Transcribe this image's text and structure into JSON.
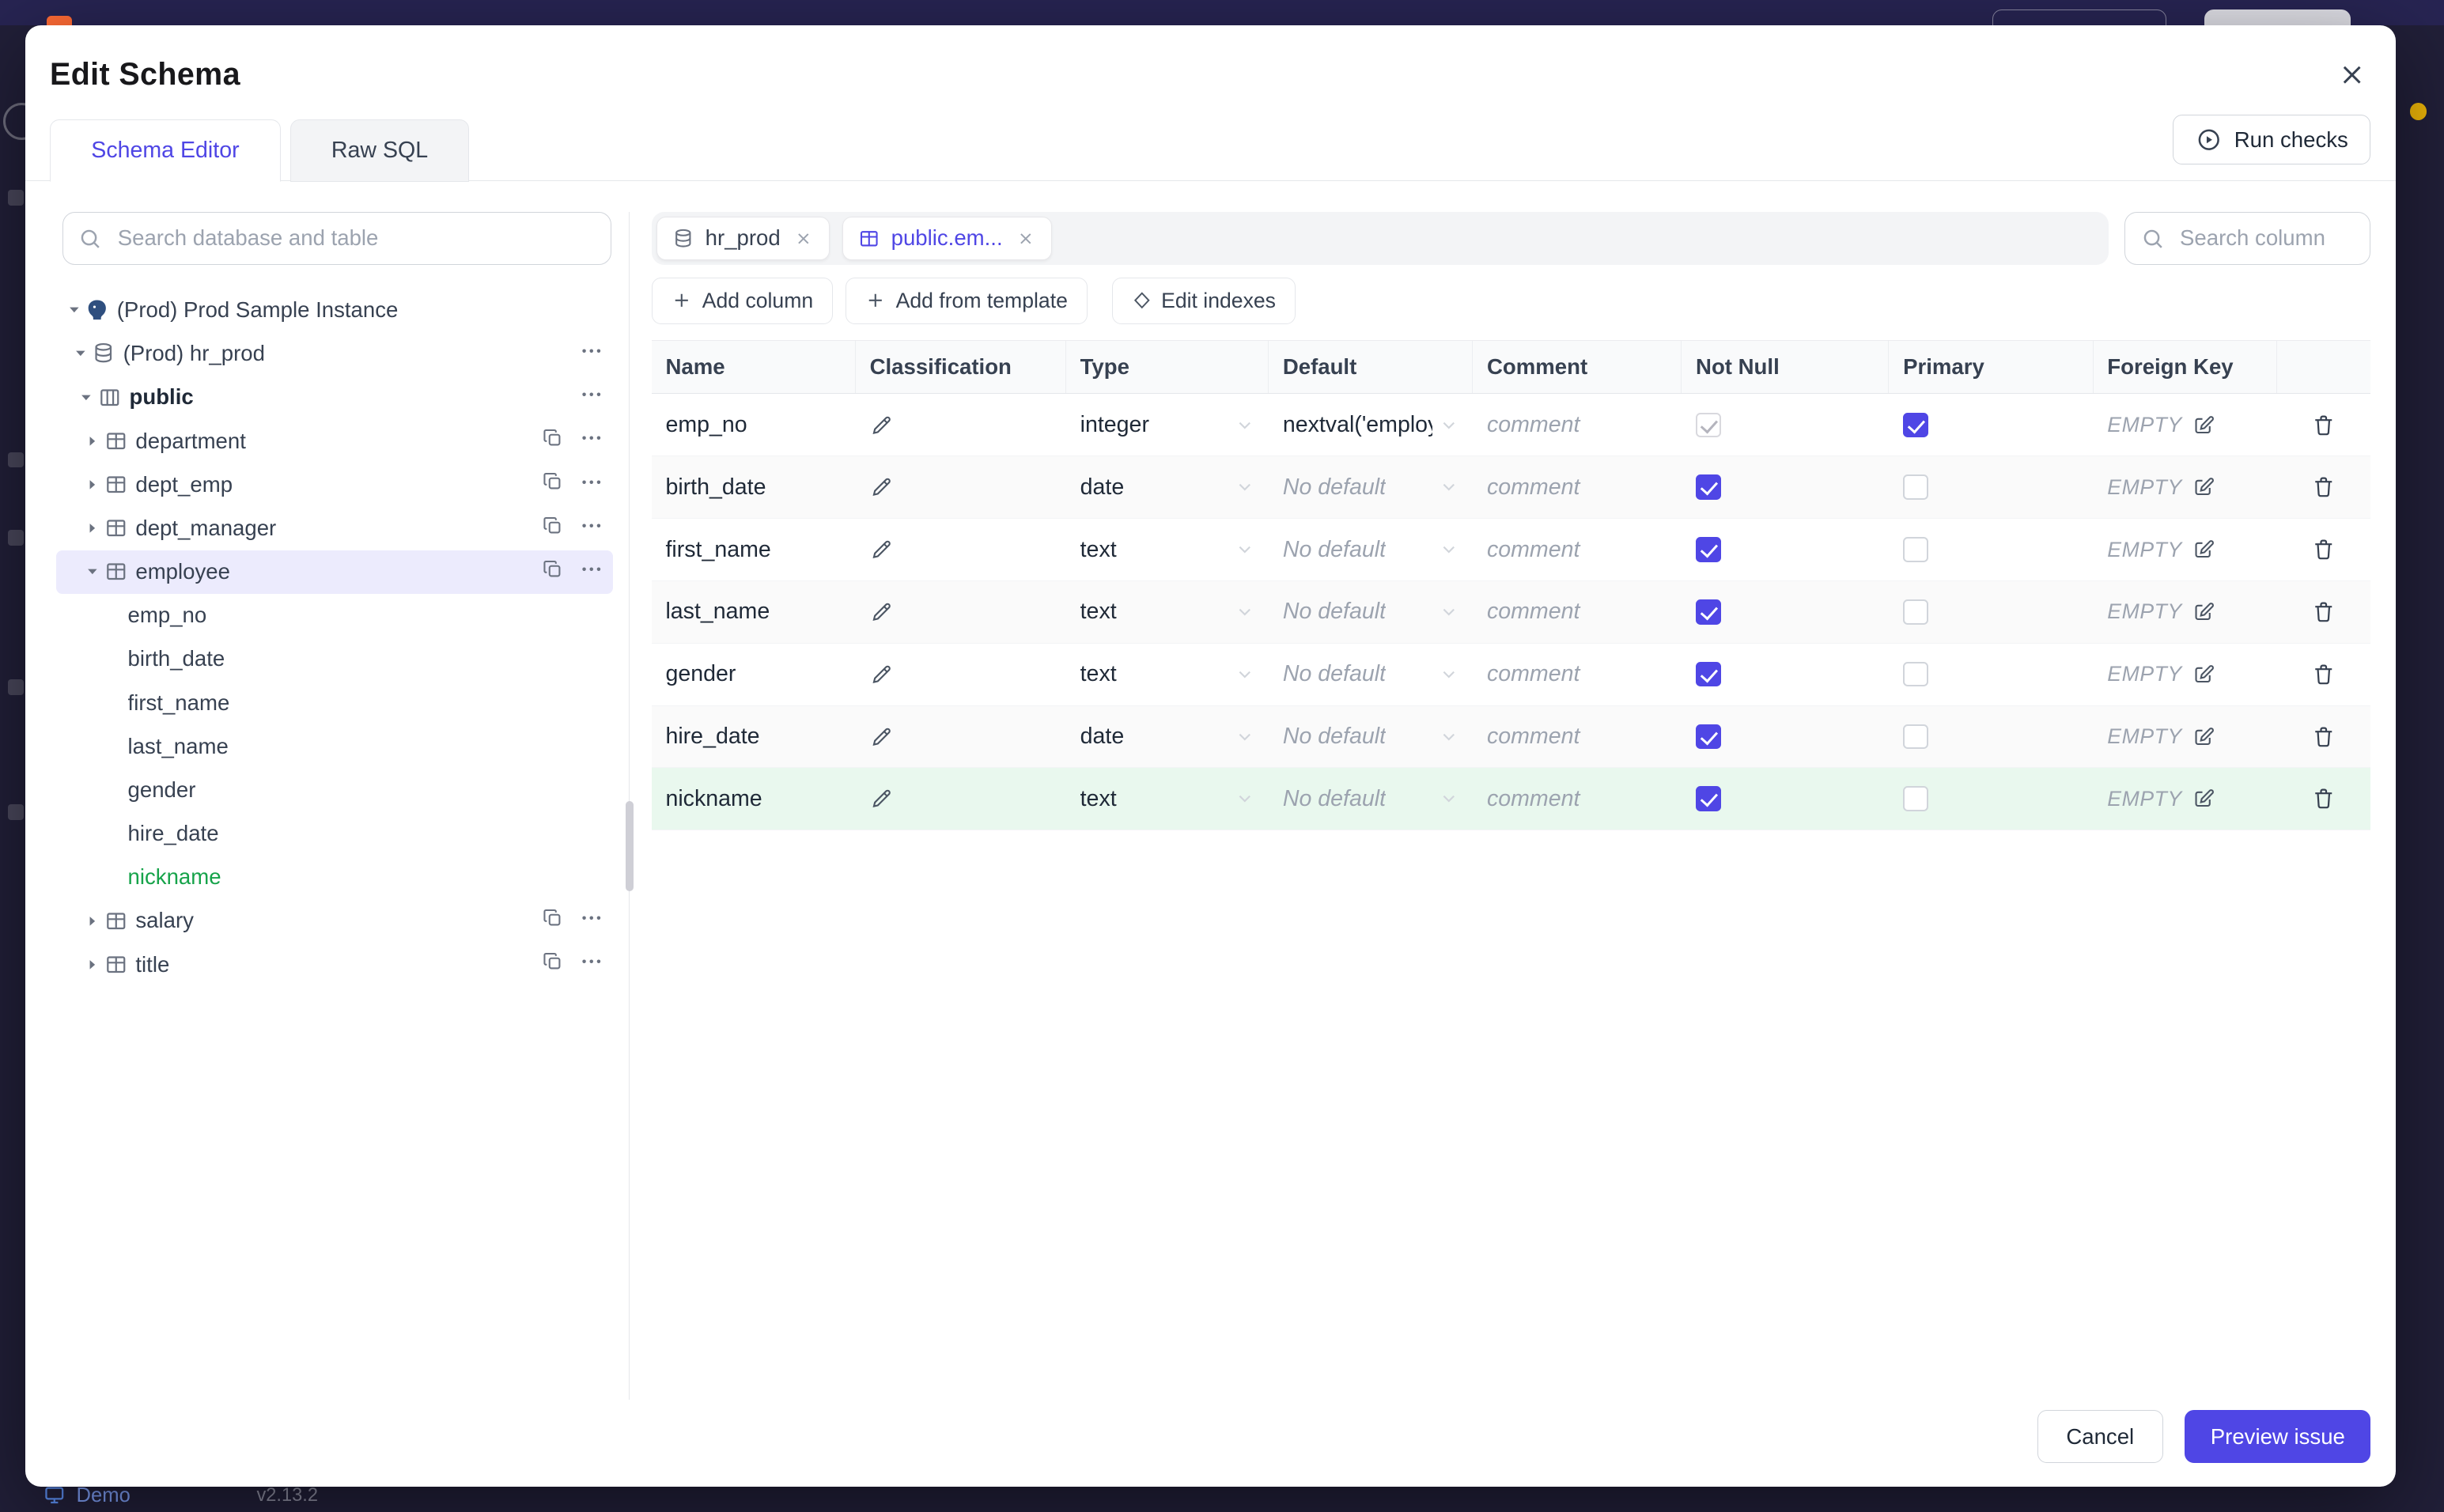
{
  "backdrop": {
    "demo_label": "Demo",
    "version": "v2.13.2"
  },
  "modal": {
    "title": "Edit Schema",
    "run_checks_label": "Run checks",
    "tabs": [
      {
        "label": "Schema Editor"
      },
      {
        "label": "Raw SQL"
      }
    ],
    "tree": {
      "search_placeholder": "Search database and table",
      "instance_label": "(Prod) Prod Sample Instance",
      "database_label": "(Prod) hr_prod",
      "schema_label": "public",
      "nodes": [
        {
          "type": "table",
          "label": "department"
        },
        {
          "type": "table",
          "label": "dept_emp"
        },
        {
          "type": "table",
          "label": "dept_manager"
        },
        {
          "type": "table",
          "label": "employee",
          "selected": true,
          "expanded": true
        },
        {
          "type": "column",
          "label": "emp_no"
        },
        {
          "type": "column",
          "label": "birth_date"
        },
        {
          "type": "column",
          "label": "first_name"
        },
        {
          "type": "column",
          "label": "last_name"
        },
        {
          "type": "column",
          "label": "gender"
        },
        {
          "type": "column",
          "label": "hire_date"
        },
        {
          "type": "column",
          "label": "nickname",
          "status": "new"
        },
        {
          "type": "table",
          "label": "salary"
        },
        {
          "type": "table",
          "label": "title"
        }
      ]
    },
    "editor": {
      "chips": [
        {
          "label": "hr_prod"
        },
        {
          "label": "public.em...",
          "active": true
        }
      ],
      "search_placeholder": "Search column",
      "add_column_label": "Add column",
      "add_from_template_label": "Add from template",
      "edit_indexes_label": "Edit indexes",
      "headers": [
        "Name",
        "Classification",
        "Type",
        "Default",
        "Comment",
        "Not Null",
        "Primary",
        "Foreign Key"
      ],
      "rows": [
        {
          "name": "emp_no",
          "type": "integer",
          "default": "nextval('employ",
          "default_placeholder": false,
          "comment": "comment",
          "not_null": "checked-disabled",
          "primary": "checked",
          "foreign_key": "EMPTY"
        },
        {
          "name": "birth_date",
          "type": "date",
          "default": "No default",
          "default_placeholder": true,
          "comment": "comment",
          "not_null": "checked",
          "primary": "unchecked",
          "foreign_key": "EMPTY"
        },
        {
          "name": "first_name",
          "type": "text",
          "default": "No default",
          "default_placeholder": true,
          "comment": "comment",
          "not_null": "checked",
          "primary": "unchecked",
          "foreign_key": "EMPTY"
        },
        {
          "name": "last_name",
          "type": "text",
          "default": "No default",
          "default_placeholder": true,
          "comment": "comment",
          "not_null": "checked",
          "primary": "unchecked",
          "foreign_key": "EMPTY"
        },
        {
          "name": "gender",
          "type": "text",
          "default": "No default",
          "default_placeholder": true,
          "comment": "comment",
          "not_null": "checked",
          "primary": "unchecked",
          "foreign_key": "EMPTY"
        },
        {
          "name": "hire_date",
          "type": "date",
          "default": "No default",
          "default_placeholder": true,
          "comment": "comment",
          "not_null": "checked",
          "primary": "unchecked",
          "foreign_key": "EMPTY"
        },
        {
          "name": "nickname",
          "type": "text",
          "default": "No default",
          "default_placeholder": true,
          "comment": "comment",
          "not_null": "checked",
          "primary": "unchecked",
          "foreign_key": "EMPTY",
          "status": "new"
        }
      ]
    },
    "footer": {
      "cancel_label": "Cancel",
      "preview_label": "Preview issue"
    }
  }
}
